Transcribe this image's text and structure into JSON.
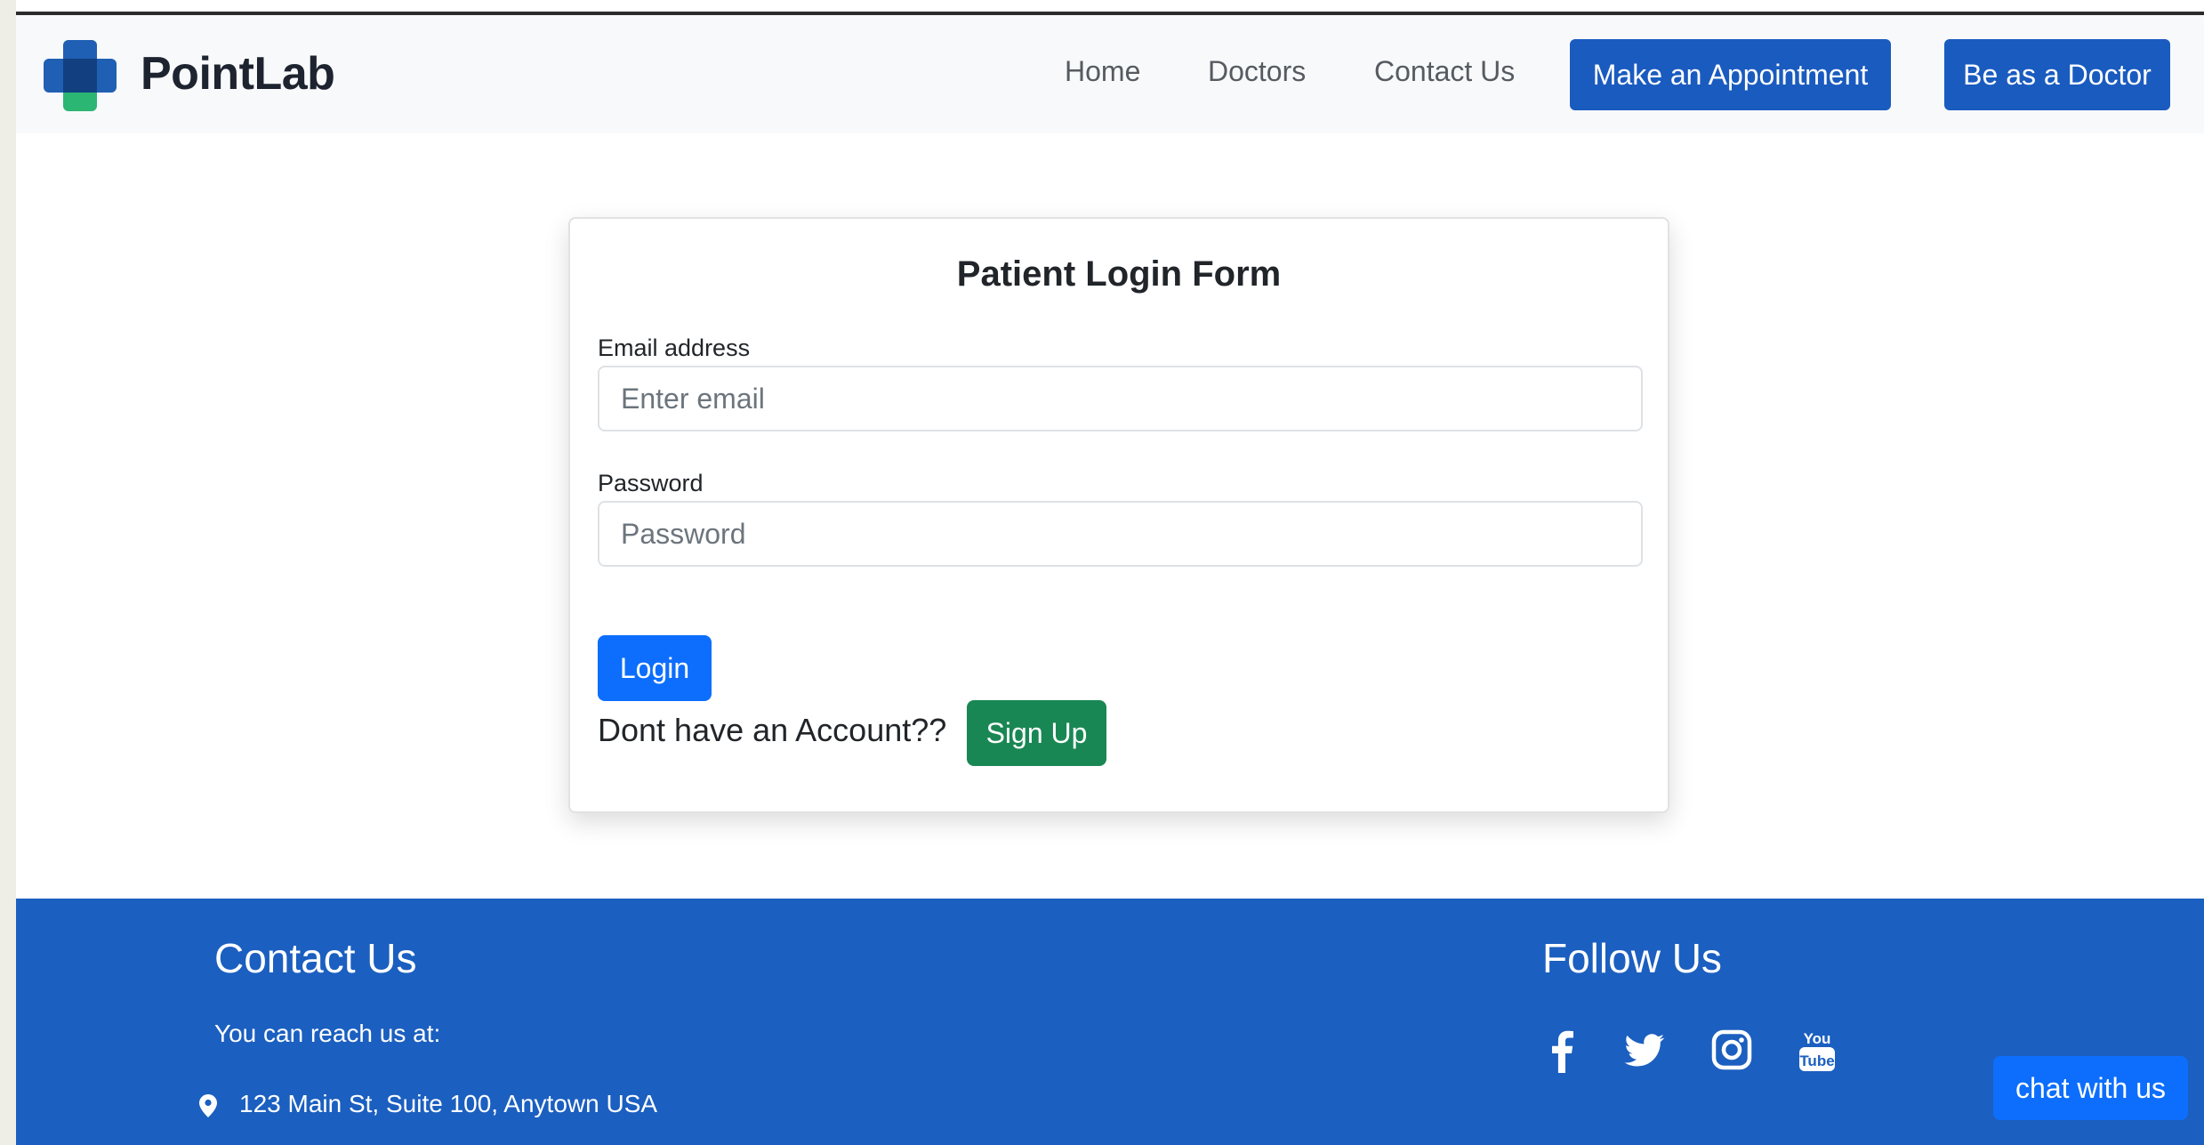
{
  "brand": {
    "name": "PointLab"
  },
  "nav": {
    "links": [
      "Home",
      "Doctors",
      "Contact Us"
    ],
    "appointment_button": "Make an Appointment",
    "doctor_button": "Be as a Doctor"
  },
  "login_form": {
    "title": "Patient Login Form",
    "email_label": "Email address",
    "email_placeholder": "Enter email",
    "email_value": "",
    "password_label": "Password",
    "password_placeholder": "Password",
    "password_value": "",
    "login_button": "Login",
    "no_account_text": "Dont have an Account??",
    "signup_button": "Sign Up"
  },
  "footer": {
    "contact_title": "Contact Us",
    "contact_intro": "You can reach us at:",
    "address": "123 Main St, Suite 100, Anytown USA",
    "follow_title": "Follow Us",
    "social_icons": [
      "facebook-icon",
      "twitter-icon",
      "instagram-icon",
      "youtube-icon"
    ]
  },
  "chat": {
    "label": "chat with us"
  },
  "colors": {
    "primary": "#0d6efd",
    "nav_button": "#1a5bbf",
    "footer": "#1b5fc0",
    "success": "#198754",
    "logo_blue": "#1f5fb4",
    "logo_green": "#2bb673"
  }
}
